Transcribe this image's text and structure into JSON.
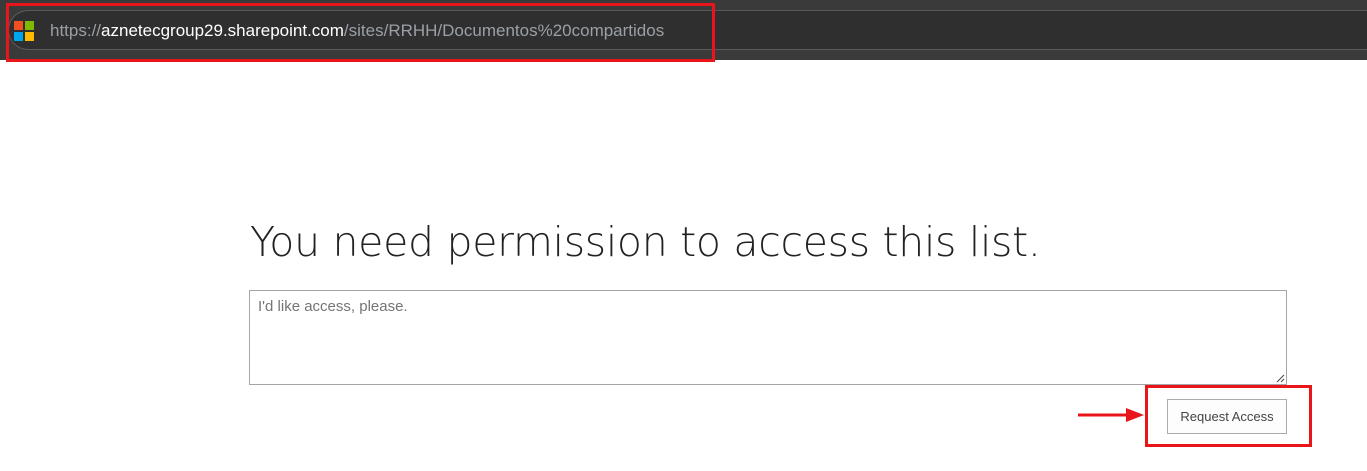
{
  "browser": {
    "url_scheme": "https://",
    "url_host": "aznetecgroup29.sharepoint.com",
    "url_path": "/sites/RRHH/Documentos%20compartidos",
    "logo_colors": [
      "#f25022",
      "#7fba00",
      "#00a4ef",
      "#ffb900"
    ]
  },
  "page": {
    "title": "You need permission to access this list.",
    "message_placeholder": "I'd like access, please.",
    "request_button_label": "Request Access"
  },
  "annotations": {
    "highlight_color": "#e8151b"
  }
}
